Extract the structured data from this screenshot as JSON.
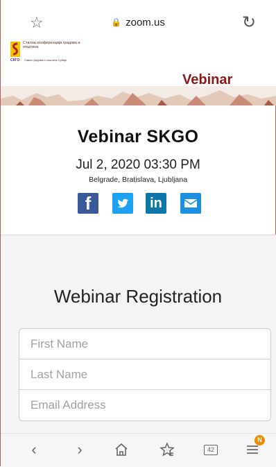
{
  "browser": {
    "url": "zoom.us",
    "tab_count": "42",
    "menu_badge": "N"
  },
  "banner": {
    "logo_text": "Стална конференција градова и општина",
    "logo_acronym": "СКГО",
    "logo_sub": "Савез градова и општина Србије",
    "title": "Vebinar"
  },
  "event": {
    "title": "Vebinar SKGO",
    "date": "Jul 2, 2020 03:30 PM",
    "timezone": "Belgrade, Bratislava, Ljubljana"
  },
  "social": {
    "facebook": "f",
    "linkedin": "in"
  },
  "registration": {
    "title": "Webinar Registration",
    "first_name_placeholder": "First Name",
    "last_name_placeholder": "Last Name",
    "email_placeholder": "Email Address"
  },
  "colors": {
    "banner_title": "#8a1a1a",
    "facebook": "#3b5998",
    "twitter": "#1da1f2",
    "linkedin": "#0e76a8",
    "email": "#1d8fe0",
    "badge": "#f08a00"
  }
}
